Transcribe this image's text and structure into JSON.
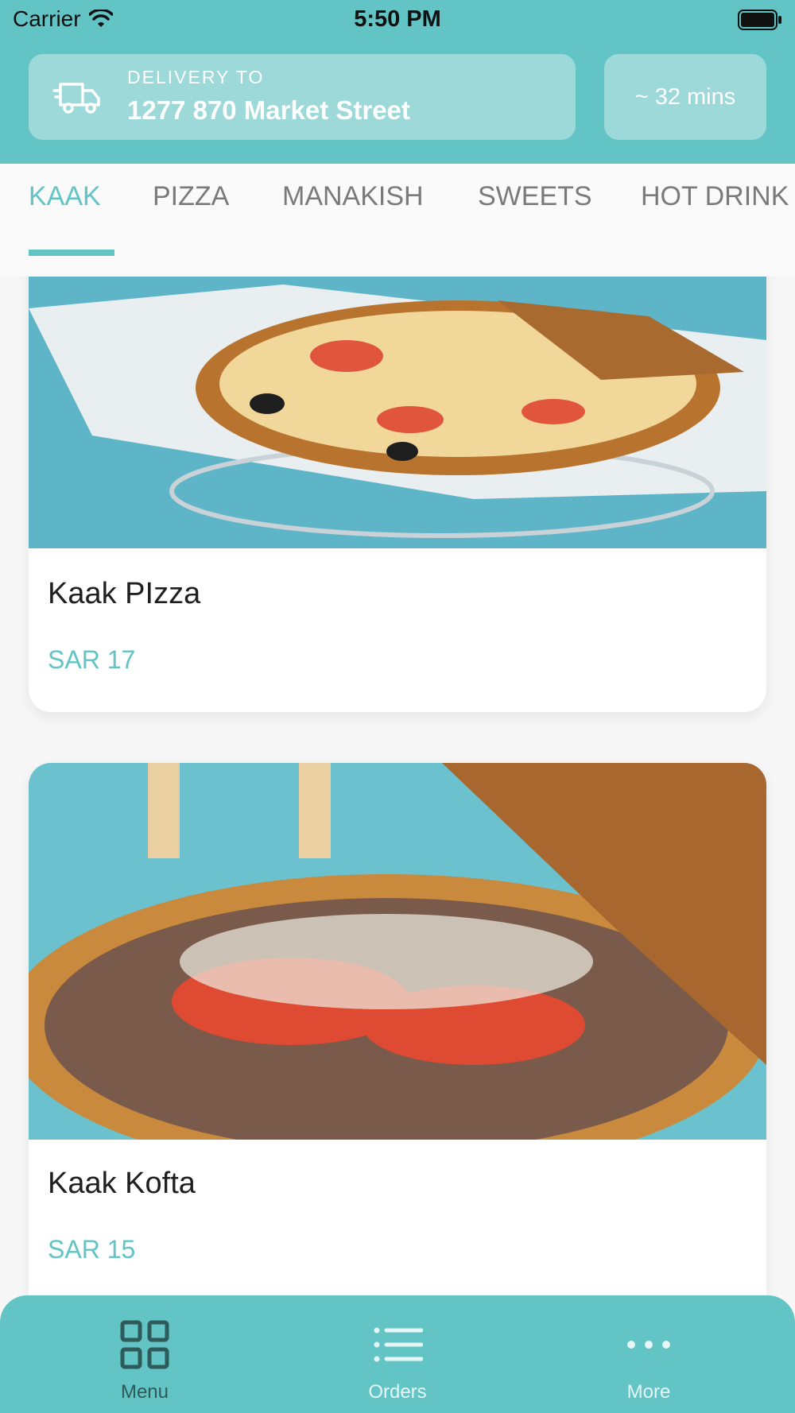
{
  "status_bar": {
    "carrier": "Carrier",
    "time": "5:50 PM"
  },
  "header": {
    "delivery_label": "DELIVERY TO",
    "delivery_address": "1277 870 Market Street",
    "eta": "~ 32 mins"
  },
  "tabs": [
    {
      "label": "KAAK",
      "active": true
    },
    {
      "label": "PIZZA",
      "active": false
    },
    {
      "label": "MANAKISH",
      "active": false
    },
    {
      "label": "SWEETS",
      "active": false
    },
    {
      "label": "HOT DRINK",
      "active": false
    }
  ],
  "products": [
    {
      "name": "Kaak PIzza",
      "price": "SAR 17"
    },
    {
      "name": "Kaak Kofta",
      "price": "SAR 15"
    }
  ],
  "bottom_nav": [
    {
      "label": "Menu",
      "icon": "grid-icon",
      "active": true
    },
    {
      "label": "Orders",
      "icon": "list-icon",
      "active": false
    },
    {
      "label": "More",
      "icon": "more-icon",
      "active": false
    }
  ],
  "colors": {
    "accent": "#62c4c4",
    "card_bg": "#9dd9d8",
    "active_nav": "#2e5a5a",
    "inactive_nav": "#e6f6f6"
  }
}
